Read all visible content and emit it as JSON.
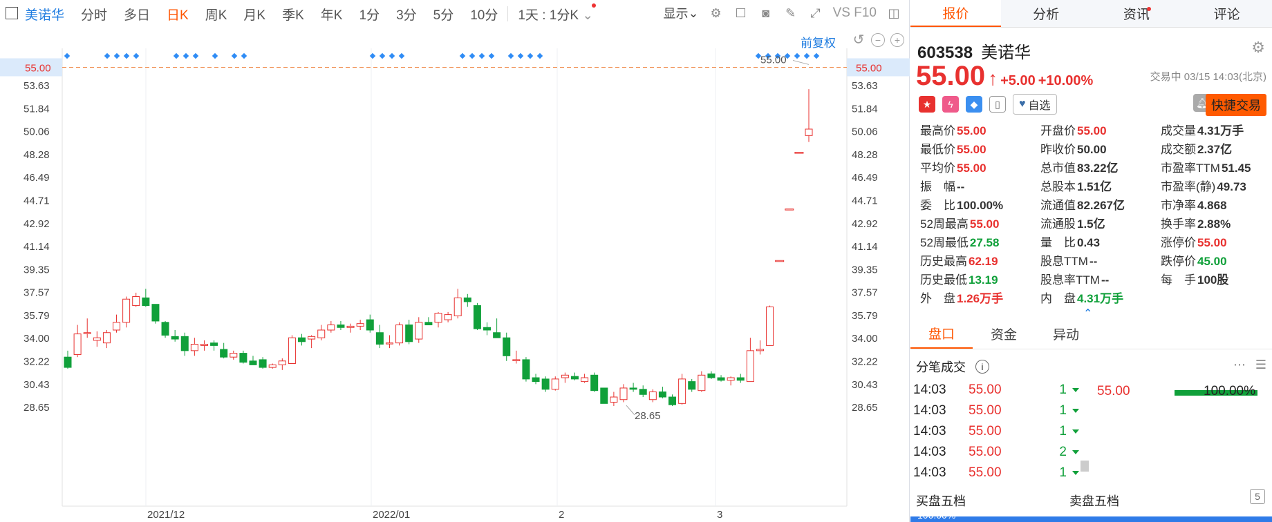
{
  "toolbar": {
    "stock_name": "美诺华",
    "periods": [
      "分时",
      "多日",
      "日K",
      "周K",
      "月K",
      "季K",
      "年K",
      "1分",
      "3分",
      "5分",
      "10分"
    ],
    "active_period": "日K",
    "kline_select": "1天 : 1分K",
    "display_label": "显示",
    "f10_label": "VS F10"
  },
  "chart_header": {
    "adjust_label": "前复权"
  },
  "chart_data": {
    "type": "candlestick",
    "y_ticks": [
      "53.63",
      "51.84",
      "50.06",
      "48.28",
      "46.49",
      "44.71",
      "42.92",
      "41.14",
      "39.35",
      "37.57",
      "35.79",
      "34.00",
      "32.22",
      "30.43",
      "28.65"
    ],
    "current_price_label": "55.00",
    "x_labels": [
      "2021/12",
      "2022/01",
      "2",
      "3"
    ],
    "high_marker": "55.00",
    "low_marker": "28.65",
    "ylim": [
      27.5,
      55.5
    ],
    "candles": [
      {
        "o": 32.5,
        "h": 33.0,
        "l": 31.6,
        "c": 31.7
      },
      {
        "o": 32.7,
        "h": 35.0,
        "l": 32.5,
        "c": 34.3
      },
      {
        "o": 34.4,
        "h": 35.5,
        "l": 34.0,
        "c": 34.4
      },
      {
        "o": 33.8,
        "h": 34.5,
        "l": 33.3,
        "c": 34.0
      },
      {
        "o": 33.6,
        "h": 34.6,
        "l": 33.2,
        "c": 34.4
      },
      {
        "o": 34.6,
        "h": 35.8,
        "l": 34.4,
        "c": 35.2
      },
      {
        "o": 35.2,
        "h": 37.2,
        "l": 34.8,
        "c": 37.0
      },
      {
        "o": 36.5,
        "h": 37.5,
        "l": 36.4,
        "c": 37.2
      },
      {
        "o": 37.1,
        "h": 37.8,
        "l": 36.4,
        "c": 36.5
      },
      {
        "o": 36.6,
        "h": 36.6,
        "l": 35.1,
        "c": 35.3
      },
      {
        "o": 35.2,
        "h": 35.3,
        "l": 34.0,
        "c": 34.2
      },
      {
        "o": 34.1,
        "h": 34.6,
        "l": 33.7,
        "c": 33.9
      },
      {
        "o": 34.1,
        "h": 34.4,
        "l": 32.6,
        "c": 33.0
      },
      {
        "o": 33.0,
        "h": 34.0,
        "l": 32.6,
        "c": 33.5
      },
      {
        "o": 33.4,
        "h": 33.8,
        "l": 33.0,
        "c": 33.5
      },
      {
        "o": 33.6,
        "h": 33.8,
        "l": 33.0,
        "c": 33.4
      },
      {
        "o": 33.1,
        "h": 33.6,
        "l": 32.4,
        "c": 32.5
      },
      {
        "o": 32.5,
        "h": 33.0,
        "l": 32.3,
        "c": 32.8
      },
      {
        "o": 32.8,
        "h": 33.0,
        "l": 32.0,
        "c": 32.1
      },
      {
        "o": 32.2,
        "h": 32.6,
        "l": 31.9,
        "c": 31.9
      },
      {
        "o": 32.3,
        "h": 32.5,
        "l": 31.6,
        "c": 31.7
      },
      {
        "o": 31.7,
        "h": 32.0,
        "l": 31.6,
        "c": 31.9
      },
      {
        "o": 31.9,
        "h": 32.4,
        "l": 31.5,
        "c": 32.2
      },
      {
        "o": 32.0,
        "h": 34.2,
        "l": 32.0,
        "c": 34.0
      },
      {
        "o": 34.0,
        "h": 34.3,
        "l": 33.4,
        "c": 33.7
      },
      {
        "o": 33.9,
        "h": 34.2,
        "l": 33.2,
        "c": 34.1
      },
      {
        "o": 34.0,
        "h": 35.0,
        "l": 33.8,
        "c": 34.6
      },
      {
        "o": 34.6,
        "h": 35.3,
        "l": 34.4,
        "c": 35.0
      },
      {
        "o": 35.0,
        "h": 35.3,
        "l": 34.6,
        "c": 34.8
      },
      {
        "o": 34.8,
        "h": 35.1,
        "l": 34.4,
        "c": 34.9
      },
      {
        "o": 34.9,
        "h": 35.4,
        "l": 34.6,
        "c": 35.1
      },
      {
        "o": 35.4,
        "h": 35.8,
        "l": 34.4,
        "c": 34.6
      },
      {
        "o": 34.4,
        "h": 35.0,
        "l": 33.2,
        "c": 33.5
      },
      {
        "o": 33.6,
        "h": 34.2,
        "l": 33.2,
        "c": 33.6
      },
      {
        "o": 33.6,
        "h": 35.2,
        "l": 33.4,
        "c": 35.0
      },
      {
        "o": 35.0,
        "h": 35.4,
        "l": 33.5,
        "c": 33.7
      },
      {
        "o": 33.9,
        "h": 35.6,
        "l": 33.6,
        "c": 35.2
      },
      {
        "o": 35.2,
        "h": 35.6,
        "l": 35.0,
        "c": 35.0
      },
      {
        "o": 35.2,
        "h": 36.0,
        "l": 34.8,
        "c": 35.9
      },
      {
        "o": 35.4,
        "h": 36.0,
        "l": 35.2,
        "c": 35.8
      },
      {
        "o": 35.7,
        "h": 37.8,
        "l": 35.5,
        "c": 37.1
      },
      {
        "o": 37.1,
        "h": 37.4,
        "l": 36.4,
        "c": 36.8
      },
      {
        "o": 36.5,
        "h": 36.7,
        "l": 34.6,
        "c": 34.7
      },
      {
        "o": 34.8,
        "h": 35.2,
        "l": 34.2,
        "c": 34.6
      },
      {
        "o": 34.4,
        "h": 35.5,
        "l": 34.0,
        "c": 34.0
      },
      {
        "o": 34.0,
        "h": 34.4,
        "l": 32.2,
        "c": 32.6
      },
      {
        "o": 32.3,
        "h": 33.0,
        "l": 32.0,
        "c": 32.3
      },
      {
        "o": 32.3,
        "h": 32.5,
        "l": 30.6,
        "c": 30.8
      },
      {
        "o": 30.9,
        "h": 31.2,
        "l": 30.4,
        "c": 30.6
      },
      {
        "o": 30.8,
        "h": 31.0,
        "l": 29.8,
        "c": 30.0
      },
      {
        "o": 30.0,
        "h": 31.0,
        "l": 29.9,
        "c": 30.8
      },
      {
        "o": 30.9,
        "h": 31.3,
        "l": 30.5,
        "c": 31.1
      },
      {
        "o": 31.0,
        "h": 31.3,
        "l": 30.7,
        "c": 30.8
      },
      {
        "o": 30.6,
        "h": 31.2,
        "l": 30.5,
        "c": 30.9
      },
      {
        "o": 31.1,
        "h": 31.3,
        "l": 29.8,
        "c": 29.9
      },
      {
        "o": 30.1,
        "h": 30.1,
        "l": 28.9,
        "c": 28.9
      },
      {
        "o": 29.0,
        "h": 29.8,
        "l": 28.7,
        "c": 29.4
      },
      {
        "o": 29.2,
        "h": 30.4,
        "l": 29.0,
        "c": 30.1
      },
      {
        "o": 30.1,
        "h": 30.5,
        "l": 29.8,
        "c": 30.0
      },
      {
        "o": 30.0,
        "h": 30.3,
        "l": 29.4,
        "c": 29.6
      },
      {
        "o": 29.2,
        "h": 30.0,
        "l": 29.0,
        "c": 29.8
      },
      {
        "o": 29.8,
        "h": 30.2,
        "l": 29.3,
        "c": 29.4
      },
      {
        "o": 29.4,
        "h": 29.6,
        "l": 28.7,
        "c": 28.8
      },
      {
        "o": 28.9,
        "h": 31.2,
        "l": 28.8,
        "c": 30.8
      },
      {
        "o": 30.6,
        "h": 30.8,
        "l": 29.8,
        "c": 30.0
      },
      {
        "o": 29.9,
        "h": 31.4,
        "l": 29.8,
        "c": 31.1
      },
      {
        "o": 31.2,
        "h": 31.4,
        "l": 30.8,
        "c": 30.9
      },
      {
        "o": 30.9,
        "h": 31.1,
        "l": 30.6,
        "c": 30.7
      },
      {
        "o": 30.7,
        "h": 31.0,
        "l": 30.3,
        "c": 30.9
      },
      {
        "o": 30.9,
        "h": 31.2,
        "l": 30.5,
        "c": 30.7
      },
      {
        "o": 30.6,
        "h": 34.0,
        "l": 30.6,
        "c": 33.0
      },
      {
        "o": 33.0,
        "h": 33.8,
        "l": 32.7,
        "c": 33.1
      },
      {
        "o": 33.4,
        "h": 36.5,
        "l": 33.4,
        "c": 36.4
      },
      {
        "o": 40.0,
        "h": 40.0,
        "l": 40.0,
        "c": 40.0
      },
      {
        "o": 44.0,
        "h": 44.0,
        "l": 44.0,
        "c": 44.0
      },
      {
        "o": 48.4,
        "h": 48.4,
        "l": 48.4,
        "c": 48.4
      },
      {
        "o": 49.7,
        "h": 53.3,
        "l": 49.2,
        "c": 50.2
      }
    ]
  },
  "right_tabs": [
    "报价",
    "分析",
    "资讯",
    "评论"
  ],
  "quote": {
    "code": "603538",
    "name": "美诺华",
    "price": "55.00",
    "change": "+5.00",
    "change_pct": "+10.00%",
    "status": "交易中 03/15 14:03(北京)",
    "watch_label": "自选",
    "quick_trade_label": "快捷交易"
  },
  "stats": [
    {
      "label": "最高价",
      "value": "55.00",
      "cls": "up"
    },
    {
      "label": "开盘价",
      "value": "55.00",
      "cls": "up"
    },
    {
      "label": "成交量",
      "value": "4.31万手",
      "cls": ""
    },
    {
      "label": "最低价",
      "value": "55.00",
      "cls": "up"
    },
    {
      "label": "昨收价",
      "value": "50.00",
      "cls": ""
    },
    {
      "label": "成交额",
      "value": "2.37亿",
      "cls": ""
    },
    {
      "label": "平均价",
      "value": "55.00",
      "cls": "up"
    },
    {
      "label": "总市值",
      "value": "83.22亿",
      "cls": ""
    },
    {
      "label": "市盈率TTM",
      "value": "51.45",
      "cls": ""
    },
    {
      "label": "振　幅",
      "value": "--",
      "cls": ""
    },
    {
      "label": "总股本",
      "value": "1.51亿",
      "cls": ""
    },
    {
      "label": "市盈率(静)",
      "value": "49.73",
      "cls": ""
    },
    {
      "label": "委　比",
      "value": "100.00%",
      "cls": ""
    },
    {
      "label": "流通值",
      "value": "82.267亿",
      "cls": ""
    },
    {
      "label": "市净率",
      "value": "4.868",
      "cls": ""
    },
    {
      "label": "52周最高",
      "value": "55.00",
      "cls": "up"
    },
    {
      "label": "流通股",
      "value": "1.5亿",
      "cls": ""
    },
    {
      "label": "换手率",
      "value": "2.88%",
      "cls": ""
    },
    {
      "label": "52周最低",
      "value": "27.58",
      "cls": "down"
    },
    {
      "label": "量　比",
      "value": "0.43",
      "cls": ""
    },
    {
      "label": "涨停价",
      "value": "55.00",
      "cls": "up"
    },
    {
      "label": "历史最高",
      "value": "62.19",
      "cls": "up"
    },
    {
      "label": "股息TTM",
      "value": "--",
      "cls": ""
    },
    {
      "label": "跌停价",
      "value": "45.00",
      "cls": "down"
    },
    {
      "label": "历史最低",
      "value": "13.19",
      "cls": "down"
    },
    {
      "label": "股息率TTM",
      "value": "--",
      "cls": ""
    },
    {
      "label": "每　手",
      "value": "100股",
      "cls": ""
    },
    {
      "label": "外　盘",
      "value": "1.26万手",
      "cls": "up"
    },
    {
      "label": "内　盘",
      "value": "4.31万手",
      "cls": "down"
    }
  ],
  "sub_tabs": [
    "盘口",
    "资金",
    "异动"
  ],
  "trades_header": "分笔成交",
  "trades": [
    {
      "time": "14:03",
      "price": "55.00",
      "qty": "1"
    },
    {
      "time": "14:03",
      "price": "55.00",
      "qty": "1"
    },
    {
      "time": "14:03",
      "price": "55.00",
      "qty": "1"
    },
    {
      "time": "14:03",
      "price": "55.00",
      "qty": "2"
    },
    {
      "time": "14:03",
      "price": "55.00",
      "qty": "1"
    }
  ],
  "price_dist": {
    "price": "55.00",
    "pct": "100.00%"
  },
  "book": {
    "buy_label": "买盘五档",
    "sell_label": "卖盘五档",
    "buy_pct": "100.00%"
  },
  "colors": {
    "up": "#e8312f",
    "down": "#10a03a",
    "accent": "#ff5500",
    "link": "#1f7ce0"
  }
}
